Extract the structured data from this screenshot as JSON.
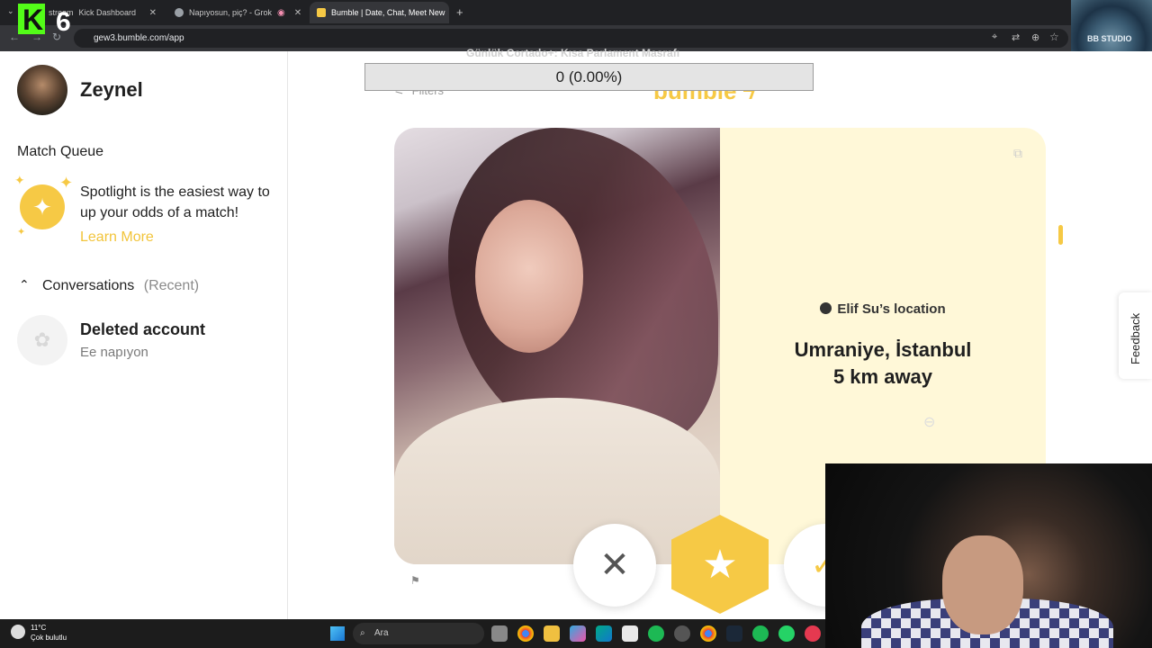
{
  "browser": {
    "tabs": [
      {
        "title": "Kick Dashboard",
        "prefix": "stream",
        "color": "#53fc18"
      },
      {
        "title": "Napıyosun, piç? - Grok",
        "color": "#9aa0a6"
      },
      {
        "title": "Bumble | Date, Chat, Meet New",
        "color": "#f6c945",
        "active": true
      }
    ],
    "url": "gew3.bumble.com/app",
    "new_tab_label": "+"
  },
  "overlay": {
    "logo_text": "K",
    "logo_number": "6",
    "studio_text": "BB STUDIO"
  },
  "sidebar": {
    "username": "Zeynel",
    "match_queue_title": "Match Queue",
    "spotlight_text": "Spotlight is the easiest way to up your odds of a match!",
    "learn_more": "Learn More",
    "conversations_title": "Conversations",
    "conversations_subtitle": "(Recent)",
    "conversation": {
      "name": "Deleted account",
      "message": "Ee napıyon"
    }
  },
  "main": {
    "banner": "Günlük Cortado+: Kısa Parlament Masrafı",
    "progress_text": "0 (0.00%)",
    "progress_fraction": 0,
    "filters_label": "Filters",
    "logo": "bumble",
    "profile": {
      "location_label": "Elif Su’s location",
      "city": "Umraniye, İstanbul",
      "distance": "5 km away"
    },
    "feedback_label": "Feedback"
  },
  "taskbar": {
    "temperature": "11°C",
    "weather": "Çok bulutlu",
    "search_placeholder": "Ara",
    "apps": [
      "file-explorer-icon",
      "chrome-icon",
      "folder-icon",
      "copilot-icon",
      "edge-icon",
      "store-icon",
      "spotify-icon",
      "discord-icon",
      "chrome-icon",
      "steam-icon",
      "spotify-icon",
      "whatsapp-icon",
      "app-icon"
    ]
  }
}
